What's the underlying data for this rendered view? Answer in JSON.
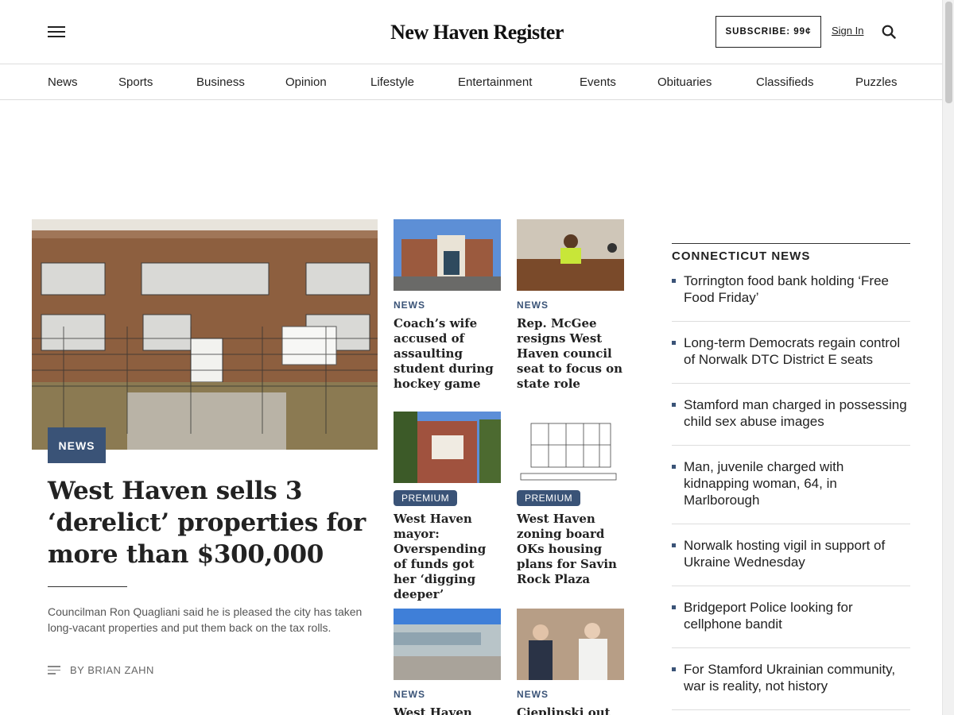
{
  "header": {
    "logo": "New Haven Register",
    "subscribe_label": "SUBSCRIBE: 99¢",
    "signin_label": "Sign In"
  },
  "nav": {
    "items": [
      "News",
      "Sports",
      "Business",
      "Opinion",
      "Lifestyle",
      "Entertainment",
      "Events",
      "Obituaries",
      "Classifieds",
      "Puzzles"
    ]
  },
  "lead": {
    "badge": "NEWS",
    "title": "West Haven sells 3 ‘derelict’ properties for more than $300,000",
    "summary": "Councilman Ron Quagliani said he is pleased the city has taken long-vacant properties and put them back on the tax rolls.",
    "byline": "BY BRIAN ZAHN"
  },
  "grid": [
    {
      "label": "NEWS",
      "premium": false,
      "headline": "Coach’s wife accused of assaulting student during hockey game"
    },
    {
      "label": "NEWS",
      "premium": false,
      "headline": "Rep. McGee resigns West Haven council seat to focus on state role"
    },
    {
      "label": "PREMIUM",
      "premium": true,
      "headline": "West Haven mayor: Overspending of funds got her ‘digging deeper’"
    },
    {
      "label": "PREMIUM",
      "premium": true,
      "headline": "West Haven zoning board OKs housing plans for Savin Rock Plaza"
    },
    {
      "label": "NEWS",
      "premium": false,
      "headline": "West Haven"
    },
    {
      "label": "NEWS",
      "premium": false,
      "headline": "Cieplinski out as"
    }
  ],
  "sidebar": {
    "title": "CONNECTICUT NEWS",
    "items": [
      "Torrington food bank holding ‘Free Food Friday’",
      "Long-term Democrats regain control of Norwalk DTC District E seats",
      "Stamford man charged in possessing child sex abuse images",
      "Man, juvenile charged with kidnapping woman, 64, in Marlborough",
      "Norwalk hosting vigil in support of Ukraine Wednesday",
      "Bridgeport Police looking for cellphone bandit",
      "For Stamford Ukrainian community, war is reality, not history"
    ]
  },
  "colors": {
    "accent": "#3a5377",
    "text": "#222222",
    "muted": "#555555"
  }
}
